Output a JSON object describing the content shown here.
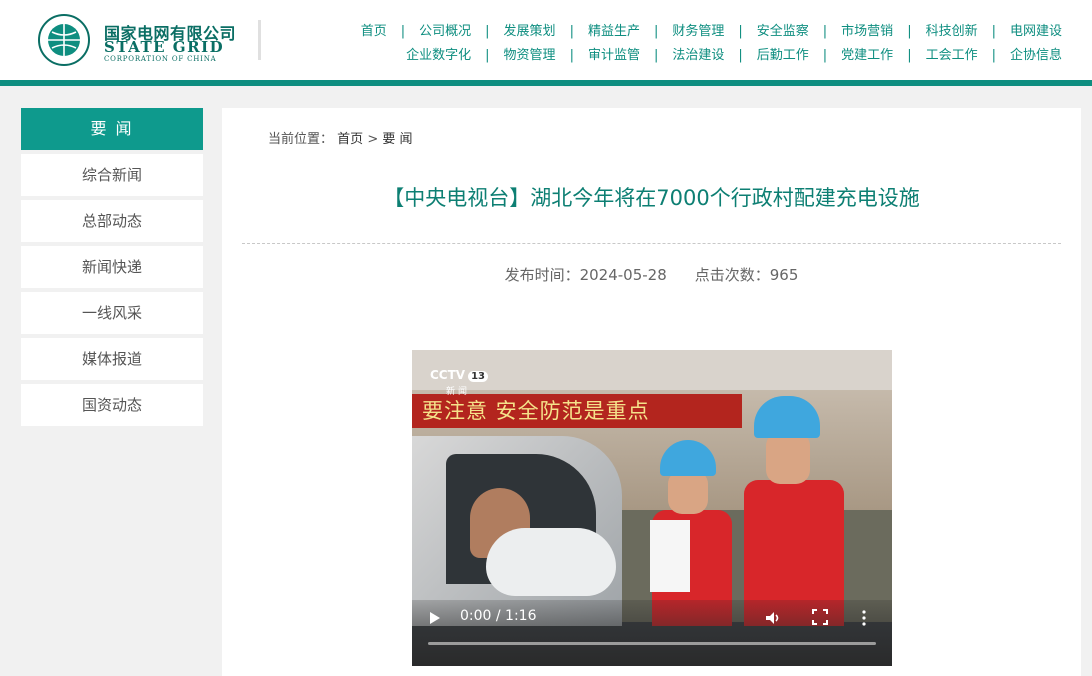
{
  "logo": {
    "cn": "国家电网有限公司",
    "en": "STATE GRID",
    "sub": "CORPORATION OF CHINA",
    "icon": "state-grid-emblem"
  },
  "nav": {
    "row1": [
      "首页",
      "公司概况",
      "发展策划",
      "精益生产",
      "财务管理",
      "安全监察",
      "市场营销",
      "科技创新",
      "电网建设"
    ],
    "row2": [
      "企业数字化",
      "物资管理",
      "审计监管",
      "法治建设",
      "后勤工作",
      "党建工作",
      "工会工作",
      "企协信息"
    ]
  },
  "sidebar": {
    "head": "要 闻",
    "items": [
      "综合新闻",
      "总部动态",
      "新闻快递",
      "一线风采",
      "媒体报道",
      "国资动态"
    ]
  },
  "breadcrumb": {
    "label": "当前位置：",
    "home": "首页",
    "sep": ">",
    "current": "要 闻"
  },
  "article": {
    "title": "【中央电视台】湖北今年将在7000个行政村配建充电设施",
    "publish": "发布时间：2024-05-28",
    "clicks": "点击次数：965"
  },
  "video": {
    "channel": "CCTV",
    "channel_num": "13",
    "channel_sub": "新闻",
    "banner": "要注意  安全防范是重点",
    "time": "0:00 / 1:16",
    "progress": 0
  },
  "colors": {
    "brand": "#0e8e80",
    "title": "#0d7f73"
  }
}
